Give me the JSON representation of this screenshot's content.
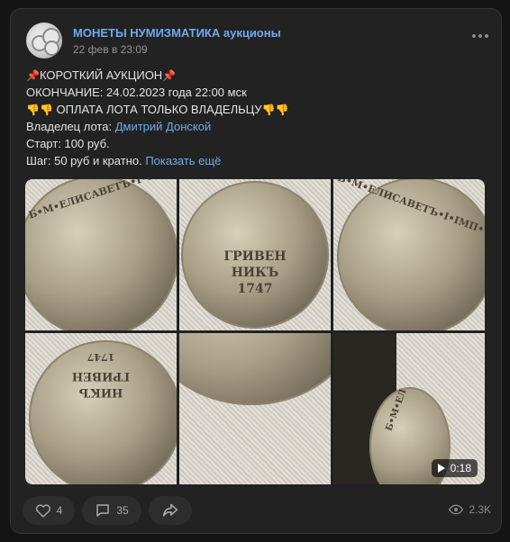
{
  "post": {
    "group_name": "МОНЕТЫ НУМИЗМАТИКА аукционы",
    "date": "22 фев в 23:09",
    "lines": {
      "title": "КОРОТКИЙ АУКЦИОН",
      "ending": "ОКОНЧАНИЕ: 24.02.2023 года 22:00 мск",
      "payment": "ОПЛАТА ЛОТА ТОЛЬКО ВЛАДЕЛЬЦУ",
      "owner_label": "Владелец лота:",
      "owner_name": "Дмитрий Донской",
      "start": "Старт: 100 руб.",
      "step": "Шаг: 50 руб и кратно.",
      "show_more": "Показать ещё"
    },
    "emoji": {
      "pin": "📌",
      "thumbs_down": "👎"
    }
  },
  "media": {
    "coin_obverse_text": "Б•М•ЕЛИСАВЕТЪ•I•IМП•",
    "coin_reverse_line1": "ГРИВЕН",
    "coin_reverse_line2": "НИКЪ",
    "coin_reverse_year": "1747",
    "coin_mirror_line1": "ГРИВЕН",
    "coin_mirror_line2": "НИКЪ",
    "coin_mirror_year": "1747",
    "coin_partial_text": "Б•М•ЕЛ",
    "video_duration": "0:18"
  },
  "footer": {
    "likes": "4",
    "comments": "35",
    "views": "2.3K"
  },
  "colors": {
    "link": "#71aaeb",
    "card": "#222222",
    "page": "#141414"
  },
  "icons": [
    "more-icon",
    "heart-icon",
    "comment-icon",
    "share-icon",
    "eye-icon",
    "play-icon"
  ]
}
